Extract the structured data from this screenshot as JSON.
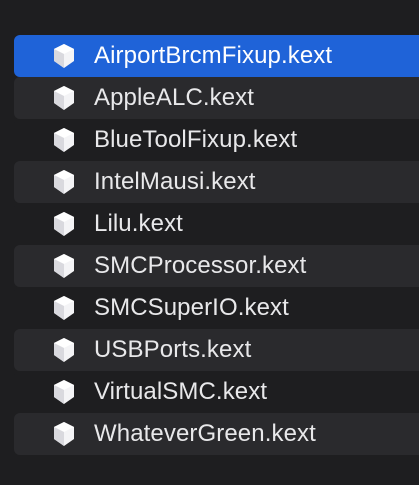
{
  "file_list": {
    "selected_index": 0,
    "icon_name": "kext-bundle-icon",
    "items": [
      {
        "label": "AirportBrcmFixup.kext"
      },
      {
        "label": "AppleALC.kext"
      },
      {
        "label": "BlueToolFixup.kext"
      },
      {
        "label": "IntelMausi.kext"
      },
      {
        "label": "Lilu.kext"
      },
      {
        "label": "SMCProcessor.kext"
      },
      {
        "label": "SMCSuperIO.kext"
      },
      {
        "label": "USBPorts.kext"
      },
      {
        "label": "VirtualSMC.kext"
      },
      {
        "label": "WhateverGreen.kext"
      }
    ]
  },
  "colors": {
    "background": "#1e1e20",
    "row_alternate": "#2a2a2d",
    "selection": "#1f63d8",
    "text": "#e8e8ea"
  }
}
